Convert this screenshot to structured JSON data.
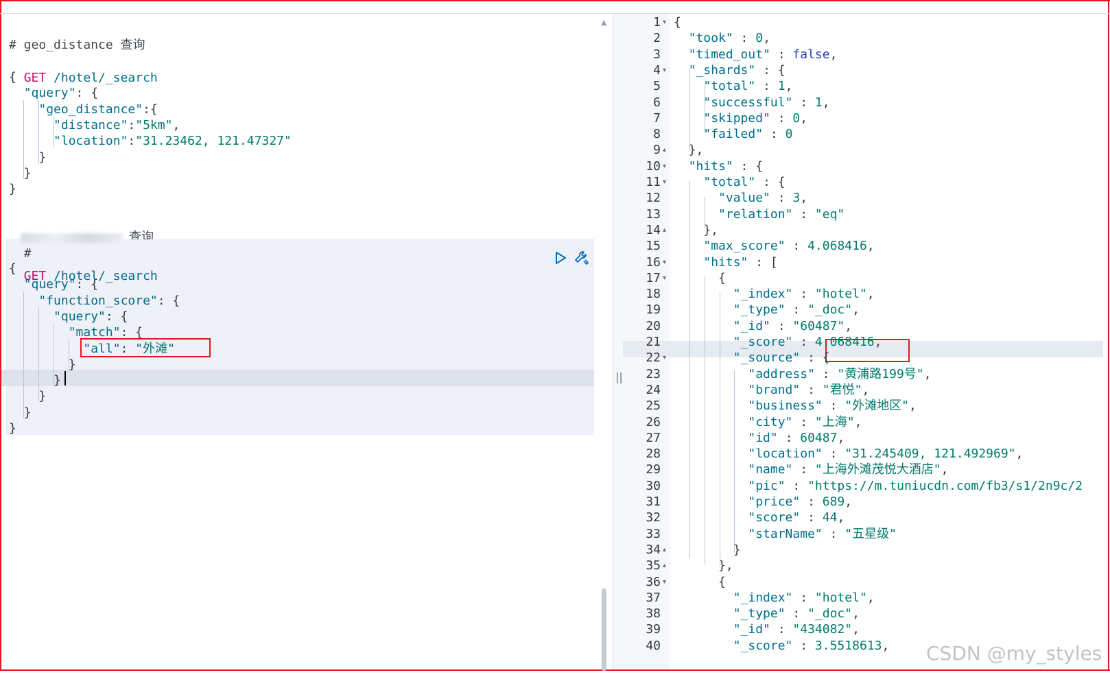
{
  "request_panel": {
    "block1": {
      "comment": "# geo_distance 查询",
      "method": "GET",
      "path": "/hotel/_search",
      "lines": [
        "{",
        "  \"query\": {",
        "    \"geo_distance\":{",
        "      \"distance\":\"5km\",",
        "      \"location\":\"31.23462, 121.47327\"",
        "    }",
        "  }",
        "}"
      ]
    },
    "block2": {
      "comment_hash": "#",
      "comment_tail": "查询",
      "method": "GET",
      "path": "/hotel/_search",
      "lines": [
        "{",
        "  \"query\": {",
        "    \"function_score\": {",
        "      \"query\": {",
        "        \"match\": {",
        "          \"all\": \"外滩\"",
        "        }",
        "      }",
        "    }",
        "  }",
        "}"
      ]
    },
    "run_icon": "play-icon",
    "settings_icon": "wrench-icon"
  },
  "response_panel": {
    "line_numbers": [
      "1",
      "2",
      "3",
      "4",
      "5",
      "6",
      "7",
      "8",
      "9",
      "10",
      "11",
      "12",
      "13",
      "14",
      "15",
      "16",
      "17",
      "18",
      "19",
      "20",
      "21",
      "22",
      "23",
      "24",
      "25",
      "26",
      "27",
      "28",
      "29",
      "30",
      "31",
      "32",
      "33",
      "34",
      "35",
      "36",
      "37",
      "38",
      "39",
      "40"
    ],
    "lines": [
      "{",
      "  \"took\" : 0,",
      "  \"timed_out\" : false,",
      "  \"_shards\" : {",
      "    \"total\" : 1,",
      "    \"successful\" : 1,",
      "    \"skipped\" : 0,",
      "    \"failed\" : 0",
      "  },",
      "  \"hits\" : {",
      "    \"total\" : {",
      "      \"value\" : 3,",
      "      \"relation\" : \"eq\"",
      "    },",
      "    \"max_score\" : 4.068416,",
      "    \"hits\" : [",
      "      {",
      "        \"_index\" : \"hotel\",",
      "        \"_type\" : \"_doc\",",
      "        \"_id\" : \"60487\",",
      "        \"_score\" : 4.068416,",
      "        \"_source\" : {",
      "          \"address\" : \"黄浦路199号\",",
      "          \"brand\" : \"君悦\",",
      "          \"business\" : \"外滩地区\",",
      "          \"city\" : \"上海\",",
      "          \"id\" : 60487,",
      "          \"location\" : \"31.245409, 121.492969\",",
      "          \"name\" : \"上海外滩茂悦大酒店\",",
      "          \"pic\" : \"https://m.tuniucdn.com/fb3/s1/2n9c/2",
      "          \"price\" : 689,",
      "          \"score\" : 44,",
      "          \"starName\" : \"五星级\"",
      "        }",
      "      },",
      "      {",
      "        \"_index\" : \"hotel\",",
      "        \"_type\" : \"_doc\",",
      "        \"_id\" : \"434082\",",
      "        \"_score\" : 3.5518613,"
    ]
  },
  "watermark": "CSDN @my_styles",
  "colors": {
    "annotation_red": "#e8141c",
    "method": "#c80a68",
    "key": "#006e8a",
    "string": "#00796b",
    "keyword": "#2c40b0"
  }
}
